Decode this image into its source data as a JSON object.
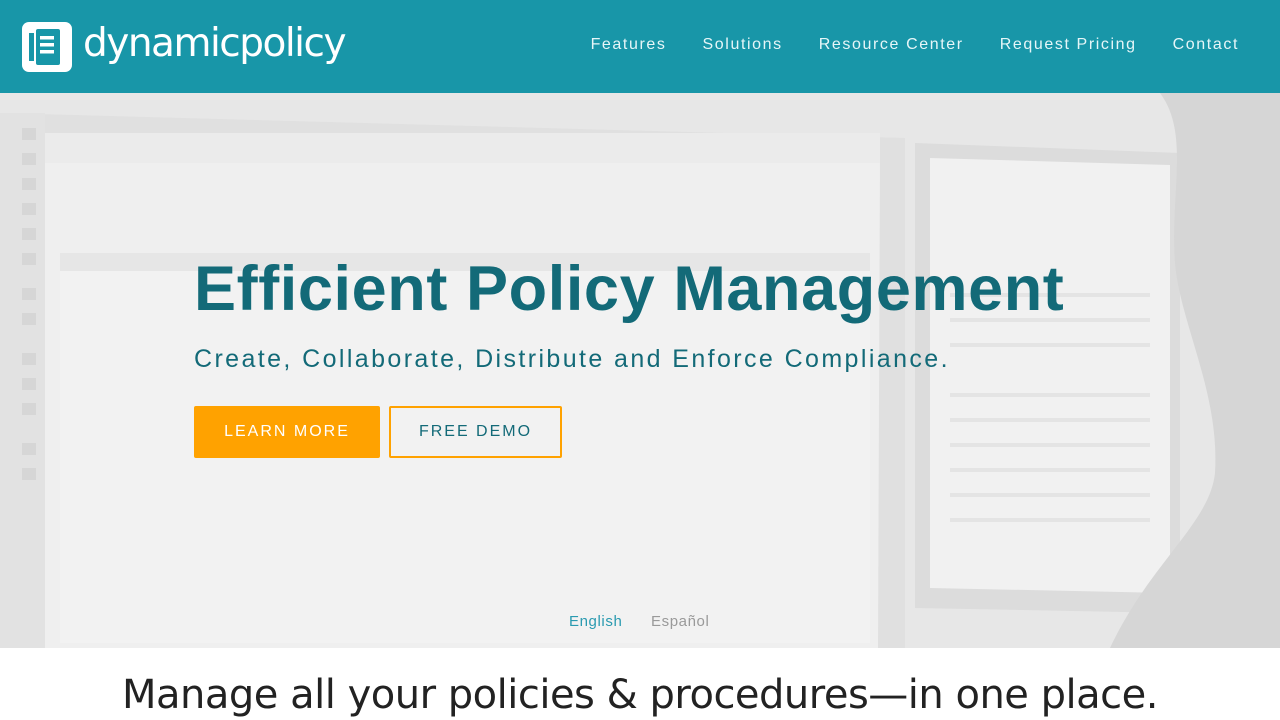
{
  "brand": {
    "name": "dynamicpolicy",
    "color": "#1896a8",
    "logo_icon": "document-icon"
  },
  "nav": {
    "items": [
      {
        "label": "Features"
      },
      {
        "label": "Solutions"
      },
      {
        "label": "Resource Center"
      },
      {
        "label": "Request Pricing"
      },
      {
        "label": "Contact"
      }
    ]
  },
  "hero": {
    "title": "Efficient Policy Management",
    "subtitle": "Create, Collaborate, Distribute and Enforce Compliance.",
    "learn_more_label": "LEARN MORE",
    "free_demo_label": "FREE DEMO",
    "accent_color": "#ffa200",
    "text_color": "#136a78"
  },
  "languages": {
    "english": "English",
    "spanish": "Español"
  },
  "tagline": "Manage all your policies & procedures—in one place."
}
